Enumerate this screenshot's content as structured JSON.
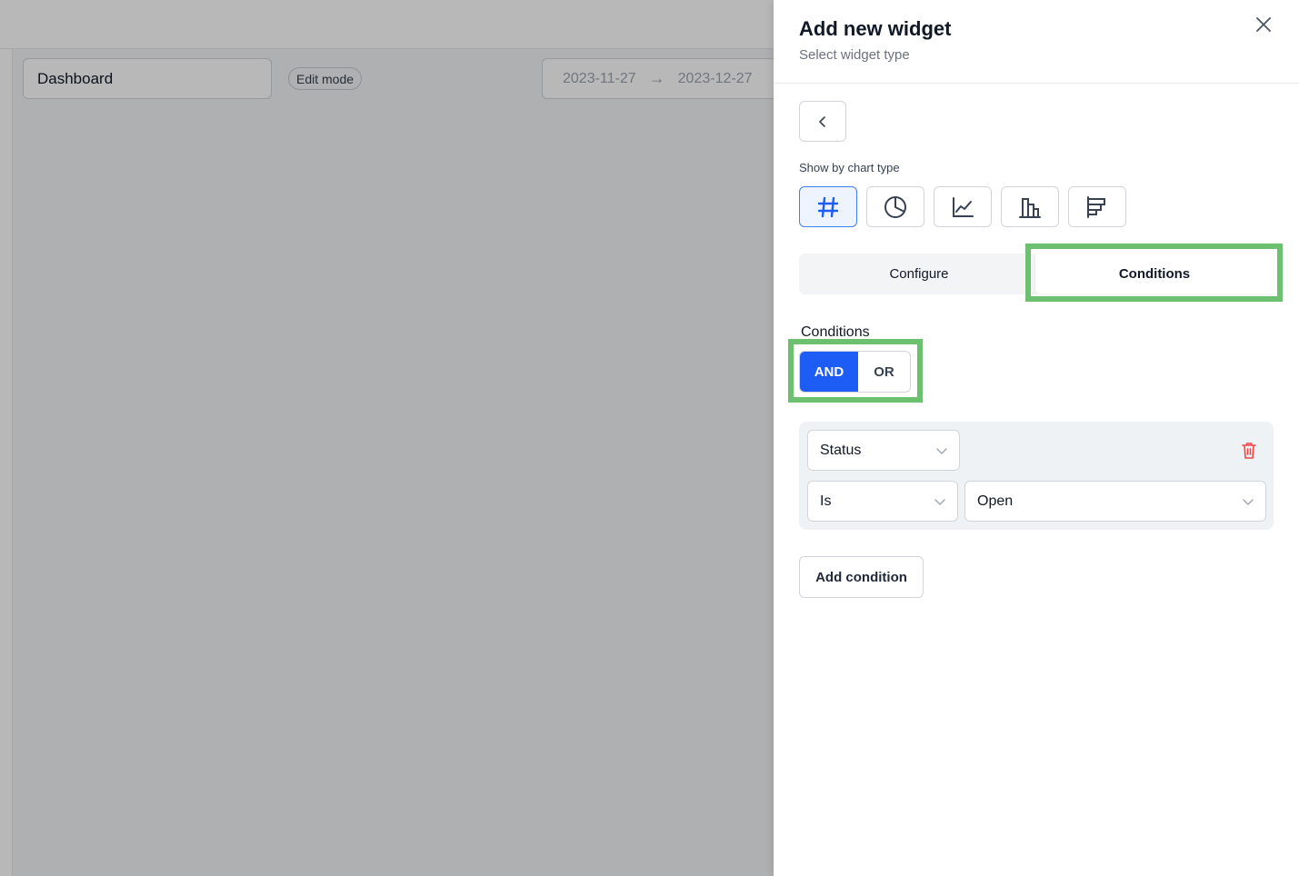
{
  "background": {
    "dashboard_name": "Dashboard",
    "edit_mode_badge": "Edit mode",
    "date_range": {
      "start": "2023-11-27",
      "end": "2023-12-27"
    }
  },
  "drawer": {
    "title": "Add new widget",
    "subtitle": "Select widget type",
    "chart_type_label": "Show by chart type",
    "chart_types": [
      {
        "icon": "hash-icon",
        "selected": true
      },
      {
        "icon": "pie-chart-icon",
        "selected": false
      },
      {
        "icon": "line-chart-icon",
        "selected": false
      },
      {
        "icon": "bar-chart-icon",
        "selected": false
      },
      {
        "icon": "horizontal-bar-chart-icon",
        "selected": false
      }
    ],
    "tabs": {
      "configure": "Configure",
      "conditions": "Conditions",
      "active": "Conditions"
    },
    "conditions_label": "Conditions",
    "logic": {
      "and": "AND",
      "or": "OR",
      "selected": "AND"
    },
    "condition_row": {
      "field": "Status",
      "operator": "Is",
      "value": "Open"
    },
    "add_condition": "Add condition"
  },
  "colors": {
    "accent": "#1d5cf5",
    "highlight": "#6cc070",
    "danger": "#ef4444"
  }
}
